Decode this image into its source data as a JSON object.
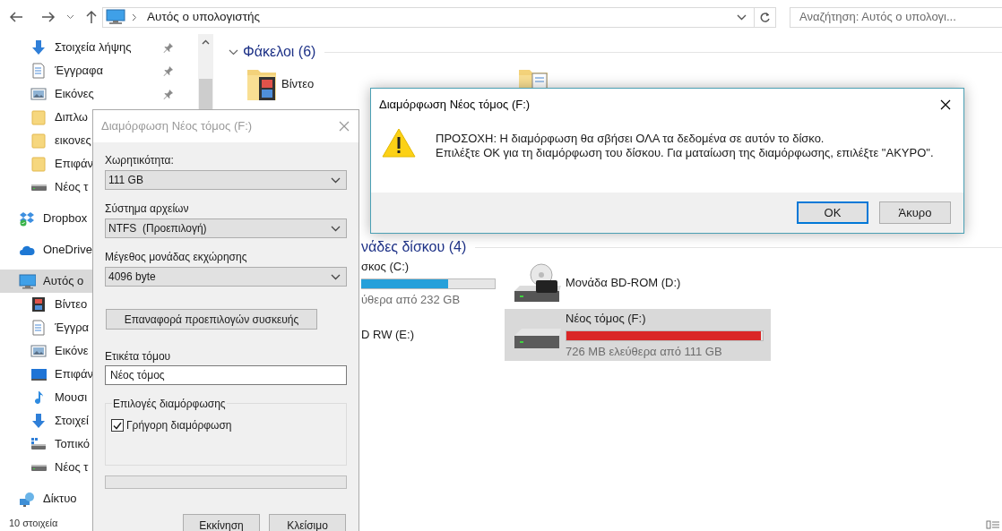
{
  "toolbar": {
    "address": "Αυτός ο υπολογιστής",
    "search": {
      "placeholder": "Αναζήτηση: Αυτός ο υπολογι..."
    }
  },
  "sidebar": {
    "quick_items": [
      {
        "label": "Στοιχεία λήψης",
        "kind": "download",
        "pinned": true,
        "selected": false
      },
      {
        "label": "Έγγραφα",
        "kind": "document",
        "pinned": true,
        "selected": false
      },
      {
        "label": "Εικόνες",
        "kind": "picture",
        "pinned": true,
        "selected": false
      },
      {
        "label": "Διπλω",
        "kind": "folder",
        "pinned": false,
        "selected": false
      },
      {
        "label": "εικονες",
        "kind": "folder",
        "pinned": false,
        "selected": false
      },
      {
        "label": "Επιφάν",
        "kind": "folder",
        "pinned": false,
        "selected": false
      },
      {
        "label": "Νέος τ",
        "kind": "drive",
        "pinned": false,
        "selected": false
      }
    ],
    "items": [
      {
        "label": "Dropbox",
        "kind": "dropbox",
        "selected": false
      },
      {
        "label": "OneDrive",
        "kind": "cloud",
        "selected": false
      },
      {
        "label": "Αυτός ο",
        "kind": "pc",
        "selected": true,
        "children": [
          {
            "label": "Βίντεο",
            "kind": "video",
            "selected": false
          },
          {
            "label": "Έγγρα",
            "kind": "document",
            "selected": false
          },
          {
            "label": "Εικόνε",
            "kind": "picture",
            "selected": false
          },
          {
            "label": "Επιφάν",
            "kind": "desktop",
            "selected": false
          },
          {
            "label": "Μουσι",
            "kind": "music",
            "selected": false
          },
          {
            "label": "Στοιχεί",
            "kind": "download",
            "selected": false
          },
          {
            "label": "Τοπικό",
            "kind": "localdrive",
            "selected": false
          },
          {
            "label": "Νέος τ",
            "kind": "drive",
            "selected": false
          }
        ]
      },
      {
        "label": "Δίκτυο",
        "kind": "network",
        "selected": false
      }
    ]
  },
  "content": {
    "folders": {
      "heading": "Φάκελοι (6)",
      "items": [
        {
          "label": "Βίντεο",
          "kind": "video"
        },
        {
          "kind": "document"
        }
      ]
    },
    "drives": {
      "heading": "νάδες δίσκου (4)",
      "items": [
        {
          "label": "σκος (C:)",
          "kind": "partial",
          "level": 0.65,
          "free": "ύθερα από 232 GB",
          "selected": false
        },
        {
          "label": "Μονάδα BD-ROM (D:)",
          "kind": "bd",
          "selected": false
        },
        {
          "label": "D RW (E:)",
          "kind": "partial",
          "selected": false
        },
        {
          "label": "Νέος τόμος (F:)",
          "kind": "drive",
          "level": 0.99,
          "free": "726 MB ελεύθερα από 111 GB",
          "selected": true
        }
      ]
    }
  },
  "status_bar": {
    "count": "10 στοιχεία"
  },
  "format_dialog": {
    "title": "Διαμόρφωση Νέος τόμος (F:)",
    "active": false,
    "fields": [
      {
        "label": "Χωρητικότητα:",
        "value": "111 GB"
      },
      {
        "label": "Σύστημα αρχείων",
        "value": "NTFS  (Προεπιλογή)"
      },
      {
        "label": "Μέγεθος μονάδας εκχώρησης",
        "value": "4096 byte"
      }
    ],
    "restore_button": "Επαναφορά προεπιλογών συσκευής",
    "volume_label": {
      "label": "Ετικέτα τόμου",
      "value": "Νέος τόμος"
    },
    "options": {
      "title": "Επιλογές διαμόρφωσης",
      "items": [
        {
          "label": "Γρήγορη διαμόρφωση",
          "checked": true
        }
      ]
    },
    "progress": {
      "level": 0
    },
    "buttons": [
      "Εκκίνηση",
      "Κλείσιμο"
    ]
  },
  "warning_dialog": {
    "title": "Διαμόρφωση Νέος τόμος (F:)",
    "active": true,
    "message": [
      "ΠΡΟΣΟΧΗ: Η διαμόρφωση θα σβήσει ΟΛΑ τα δεδομένα σε αυτόν το δίσκο.",
      "Επιλέξτε ΟΚ για τη διαμόρφωση του δίσκου.  Για ματαίωση της διαμόρφωσης, επιλέξτε \"ΑΚΥΡΟ\"."
    ],
    "buttons": [
      {
        "label": "OK",
        "default": true
      },
      {
        "label": "Άκυρο",
        "default": false
      }
    ]
  }
}
